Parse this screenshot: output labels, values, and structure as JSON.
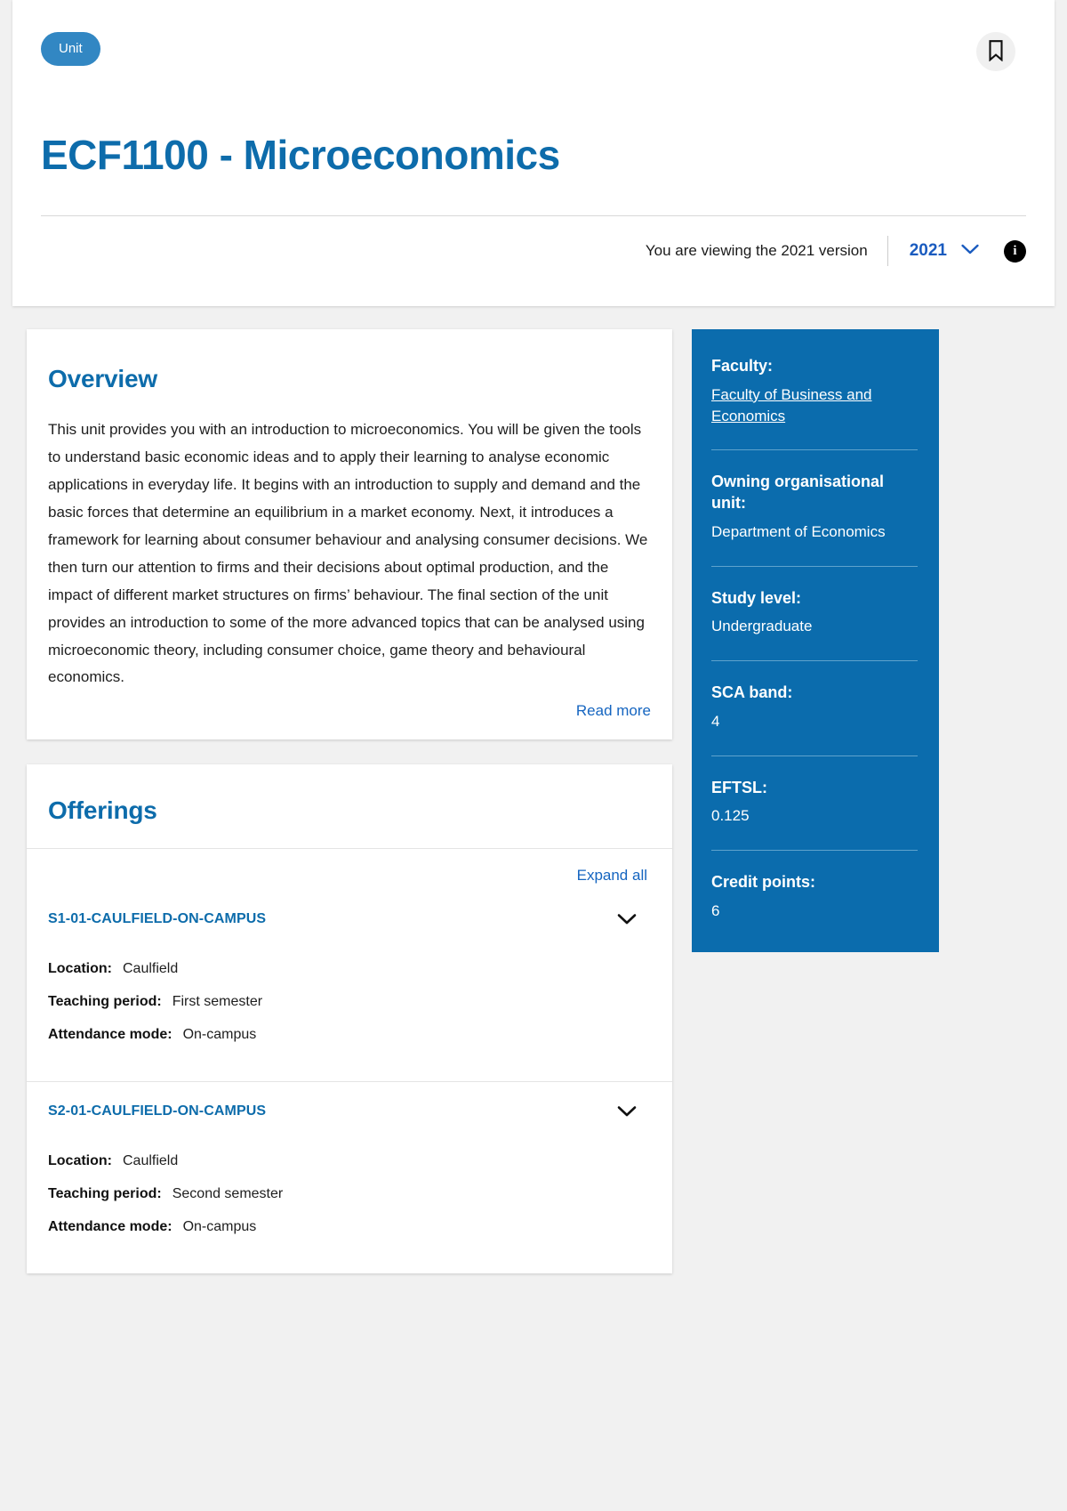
{
  "header": {
    "pill_label": "Unit",
    "bookmark_icon": "bookmark-icon",
    "title": "ECF1100 - Microeconomics",
    "version_text": "You are viewing the 2021 version",
    "version_value": "2021",
    "chevron_icon": "chevron-down-icon",
    "info_icon": "info-icon",
    "info_glyph": "i"
  },
  "overview": {
    "title": "Overview",
    "body": "This unit provides you with an introduction to microeconomics. You will be given the tools to understand basic economic ideas and to apply their learning to analyse economic applications in everyday life. It begins with an introduction to supply and demand and the basic forces that determine an equilibrium in a market economy. Next, it introduces a framework for learning about consumer behaviour and analysing consumer decisions. We then turn our attention to firms and their decisions about optimal production, and the impact of different market structures on firms’ behaviour. The final section of the unit provides an introduction to some of the more advanced topics that can be analysed using microeconomic theory, including consumer choice, game theory and behavioural economics.",
    "read_more": "Read more"
  },
  "offerings": {
    "title": "Offerings",
    "expand_all": "Expand all",
    "items": [
      {
        "code": "S1-01-CAULFIELD-ON-CAMPUS",
        "fields": [
          {
            "label": "Location:",
            "value": "Caulfield"
          },
          {
            "label": "Teaching period:",
            "value": "First semester"
          },
          {
            "label": "Attendance mode:",
            "value": "On-campus"
          }
        ]
      },
      {
        "code": "S2-01-CAULFIELD-ON-CAMPUS",
        "fields": [
          {
            "label": "Location:",
            "value": "Caulfield"
          },
          {
            "label": "Teaching period:",
            "value": "Second semester"
          },
          {
            "label": "Attendance mode:",
            "value": "On-campus"
          }
        ]
      }
    ]
  },
  "side_panel": {
    "blocks": [
      {
        "label": "Faculty:",
        "value": "Faculty of Business and Economics",
        "is_link": true
      },
      {
        "label": "Owning organisational unit:",
        "value": "Department of Economics",
        "is_link": false
      },
      {
        "label": "Study level:",
        "value": "Undergraduate",
        "is_link": false
      },
      {
        "label": "SCA band:",
        "value": "4",
        "is_link": false
      },
      {
        "label": "EFTSL:",
        "value": "0.125",
        "is_link": false
      },
      {
        "label": "Credit points:",
        "value": "6",
        "is_link": false
      }
    ]
  },
  "colors": {
    "brand_blue": "#0d6cab",
    "panel_blue": "#0b6cad",
    "pill_blue": "#3287c3",
    "link_blue": "#1565c0",
    "version_blue": "#1a5bbf",
    "page_bg": "#f1f1f1"
  }
}
